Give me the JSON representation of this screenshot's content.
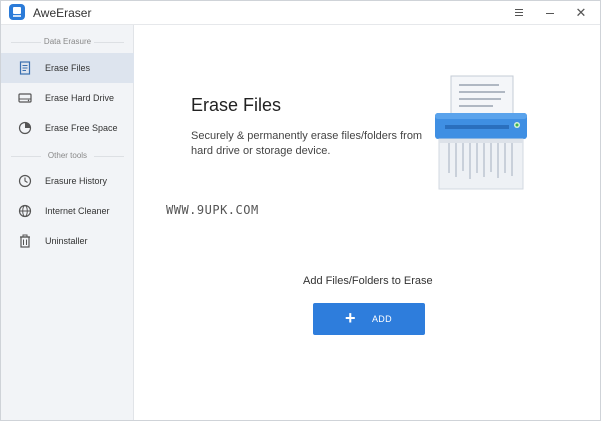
{
  "app": {
    "title": "AweEraser"
  },
  "titlebar": {
    "menu_icon": "hamburger-menu-icon",
    "minimize_icon": "minimize-icon",
    "close_glyph": "✕"
  },
  "sidebar": {
    "section_data_erasure": "Data Erasure",
    "section_other_tools": "Other tools",
    "items": [
      {
        "label": "Erase Files",
        "icon": "document-icon",
        "active": true
      },
      {
        "label": "Erase Hard Drive",
        "icon": "hard-drive-icon",
        "active": false
      },
      {
        "label": "Erase Free Space",
        "icon": "pie-chart-icon",
        "active": false
      },
      {
        "label": "Erasure History",
        "icon": "clock-icon",
        "active": false
      },
      {
        "label": "Internet Cleaner",
        "icon": "globe-icon",
        "active": false
      },
      {
        "label": "Uninstaller",
        "icon": "trash-icon",
        "active": false
      }
    ]
  },
  "main": {
    "title": "Erase Files",
    "description": "Securely & permanently erase files/folders from hard drive or storage device.",
    "watermark": "WWW.9UPK.COM",
    "add_caption": "Add Files/Folders to Erase",
    "add_button_plus": "+",
    "add_button_label": "ADD",
    "illustration": "paper-shredder-icon"
  },
  "colors": {
    "accent": "#2e7ddc",
    "sidebar_bg": "#f2f4f7",
    "active_item_bg": "#dde4ee"
  }
}
